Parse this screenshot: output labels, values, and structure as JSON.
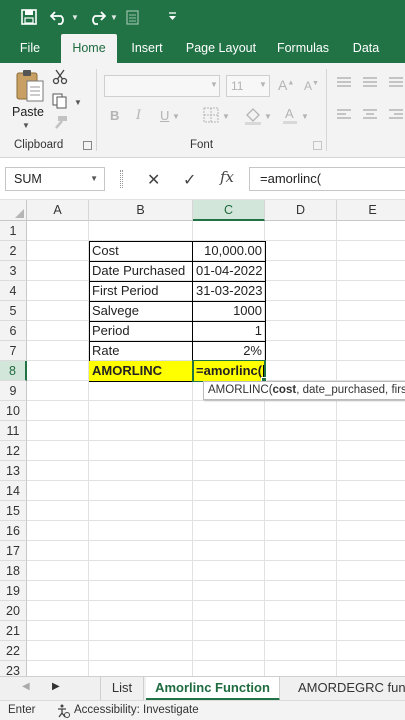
{
  "ribbon_tabs": [
    "File",
    "Home",
    "Insert",
    "Page Layout",
    "Formulas",
    "Data"
  ],
  "ribbon": {
    "paste_label": "Paste",
    "clipboard_label": "Clipboard",
    "font_label": "Font",
    "font_size": "11",
    "bold": "B",
    "italic": "I",
    "underline": "U"
  },
  "formula_bar": {
    "name_box": "SUM",
    "fx": "fx",
    "formula": "=amorlinc("
  },
  "columns": [
    "A",
    "B",
    "C",
    "D",
    "E"
  ],
  "rows": [
    "1",
    "2",
    "3",
    "4",
    "5",
    "6",
    "7",
    "8",
    "9",
    "10",
    "11",
    "12",
    "13",
    "14",
    "15",
    "16",
    "17",
    "18",
    "19",
    "20",
    "21",
    "22",
    "23"
  ],
  "table": [
    {
      "label": "Cost",
      "value": "10,000.00"
    },
    {
      "label": "Date Purchased",
      "value": "01-04-2022"
    },
    {
      "label": "First Period",
      "value": "31-03-2023"
    },
    {
      "label": "Salvege",
      "value": "1000"
    },
    {
      "label": "Period",
      "value": "1"
    },
    {
      "label": "Rate",
      "value": "2%"
    }
  ],
  "active_row": {
    "label": "AMORLINC",
    "value": "=amorlinc("
  },
  "tooltip": {
    "fn": "AMORLINC(",
    "arg_bold": "cost",
    "rest": ", date_purchased, first_period, salvage, period, rate, [basis])"
  },
  "sheet_tabs": [
    "List",
    "Amorlinc Function",
    "AMORDEGRC func"
  ],
  "status": {
    "mode": "Enter",
    "accessibility": "Accessibility: Investigate"
  },
  "colors": {
    "accent": "#217346",
    "highlight": "#ffff00"
  }
}
